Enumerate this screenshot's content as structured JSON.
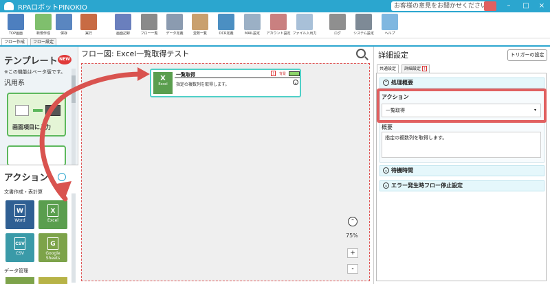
{
  "window": {
    "title": "RPAロボットPINOKIO",
    "feedback": "お客様の意見をお聞かせください",
    "controls": [
      "–",
      "□",
      "×"
    ]
  },
  "toolbar": {
    "items": [
      {
        "label": "TOP画面",
        "icon": "top-screen-icon",
        "color": "#4d7fbf"
      },
      {
        "label": "新規作成",
        "icon": "new-file-icon",
        "color": "#7fbf6d"
      },
      {
        "label": "保存",
        "icon": "save-icon",
        "color": "#5a86c0"
      },
      {
        "label": "実行",
        "icon": "run-icon",
        "color": "#c86b44"
      },
      {
        "label": "画面記録",
        "icon": "screen-record-icon",
        "color": "#6a7fbd"
      },
      {
        "label": "フロー一覧",
        "icon": "flow-list-icon",
        "color": "#8a8a8a"
      },
      {
        "label": "データ定義",
        "icon": "data-define-icon",
        "color": "#8b9bb0"
      },
      {
        "label": "変数一覧",
        "icon": "variable-list-icon",
        "color": "#c9a06e"
      },
      {
        "label": "OCR定義",
        "icon": "ocr-icon",
        "color": "#4b8fc2"
      },
      {
        "label": "MAIL設定",
        "icon": "mail-icon",
        "color": "#9bb0c5"
      },
      {
        "label": "アカウント設定",
        "icon": "account-icon",
        "color": "#c98080"
      },
      {
        "label": "ファイル入出力",
        "icon": "file-io-icon",
        "color": "#a8c0d8"
      },
      {
        "label": "ログ",
        "icon": "log-icon",
        "color": "#8f8f8f"
      },
      {
        "label": "システム設定",
        "icon": "system-settings-icon",
        "color": "#7e8a96"
      },
      {
        "label": "ヘルプ",
        "icon": "help-icon",
        "color": "#7fb7e0"
      }
    ]
  },
  "tabs": [
    "フロー作成",
    "フロー設定"
  ],
  "left": {
    "template_title": "テンプレート",
    "new_badge": "NEW",
    "beta_note": "※この機能はベータ版です。",
    "category_general": "汎用系",
    "template_card_label": "画面項目に入力",
    "action_title": "アクション",
    "category_docs": "文書作成・表計算",
    "tiles": [
      {
        "label": "Word",
        "icon": "W",
        "color": "#2f5f93"
      },
      {
        "label": "Excel",
        "icon": "X",
        "color": "#5a9e4e"
      },
      {
        "label": "CSV",
        "icon": "CSV",
        "color": "#3a9aa8"
      },
      {
        "label": "Google Sheets",
        "icon": "G",
        "color": "#7da34a"
      }
    ],
    "category_data": "データ管理"
  },
  "canvas": {
    "title": "フロー図:  Excel一覧取得テスト",
    "node": {
      "icon_label": "Excel",
      "title": "一覧取得",
      "tag": "背景",
      "description": "指定の複数列を取得します。"
    },
    "zoom": "75%",
    "zoom_in": "+",
    "zoom_out": "-"
  },
  "right": {
    "title": "詳細設定",
    "trigger_button": "トリガーの設定",
    "tabs": [
      "共通設定",
      "詳細設定"
    ],
    "section_summary": "処理概要",
    "action_label": "アクション",
    "action_value": "一覧取得",
    "overview_label": "概要",
    "overview_value": "指定の複数列を取得します。",
    "section_wait": "待機時間",
    "section_error": "エラー発生時フロー停止設定"
  },
  "colors": {
    "accent": "#2ba6cf",
    "highlight": "#e06060",
    "arrow": "#d9534f"
  }
}
